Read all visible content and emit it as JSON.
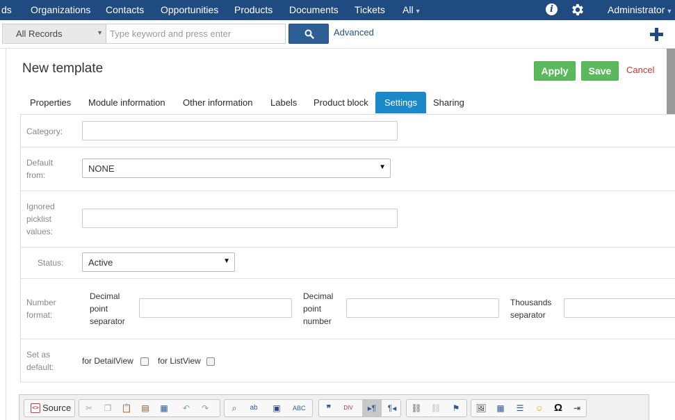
{
  "nav": {
    "items": [
      "ds",
      "Organizations",
      "Contacts",
      "Opportunities",
      "Products",
      "Documents",
      "Tickets",
      "All"
    ],
    "user": "Administrator"
  },
  "search": {
    "scope": "All Records",
    "placeholder": "Type keyword and press enter",
    "advanced": "Advanced"
  },
  "page": {
    "title": "New template",
    "apply": "Apply",
    "save": "Save",
    "cancel": "Cancel"
  },
  "tabs": [
    "Properties",
    "Module information",
    "Other information",
    "Labels",
    "Product block",
    "Settings",
    "Sharing"
  ],
  "active_tab": "Settings",
  "form": {
    "category_label": "Category:",
    "default_from_label": "Default from:",
    "default_from_value": "NONE",
    "ignored_label": "Ignored picklist values:",
    "status_label": "Status:",
    "status_value": "Active",
    "number_format_label": "Number format:",
    "decimal_separator_label": "Decimal point separator",
    "decimal_number_label": "Decimal point number",
    "thousands_label": "Thousands separator",
    "set_default_label": "Set as default:",
    "detailview_label": "for DetailView",
    "listview_label": "for ListView"
  },
  "editor": {
    "source_label": "Source"
  },
  "colors": {
    "nav_bg": "#1f4b80",
    "accent_tab": "#1b88c9",
    "save_green": "#5cb85c",
    "cancel_red": "#c0392b"
  }
}
